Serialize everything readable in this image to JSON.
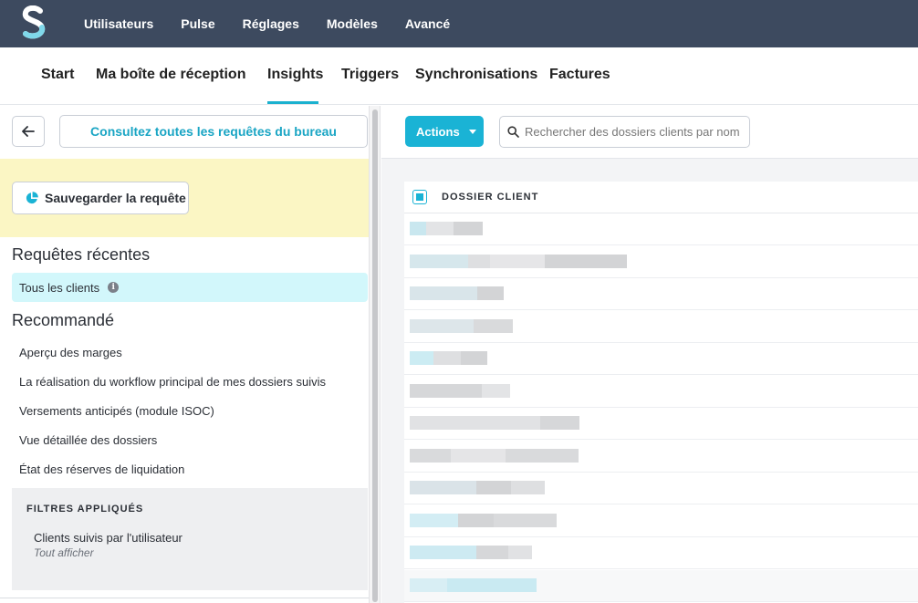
{
  "topnav": {
    "items": [
      "Utilisateurs",
      "Pulse",
      "Réglages",
      "Modèles",
      "Avancé"
    ]
  },
  "subnav": {
    "tabs": [
      "Start",
      "Ma boîte de réception",
      "Insights",
      "Triggers",
      "Synchronisations",
      "Factures"
    ],
    "active": "Insights"
  },
  "left": {
    "consult_label": "Consultez toutes les requêtes du bureau",
    "save_label": "Sauvegarder la requête",
    "recent_title": "Requêtes récentes",
    "recent_item": "Tous les clients",
    "recommended_title": "Recommandé",
    "recommended": [
      "Aperçu des marges",
      "La réalisation du workflow principal de mes dossiers suivis",
      "Versements anticipés (module ISOC)",
      "Vue détaillée des dossiers",
      "État des réserves de liquidation"
    ],
    "filters": {
      "title": "FILTRES APPLIQUÉS",
      "name": "Clients suivis par l'utilisateur",
      "value": "Tout afficher"
    }
  },
  "right": {
    "actions_label": "Actions",
    "search_placeholder": "Rechercher des dossiers clients par nom",
    "column_header": "DOSSIER CLIENT",
    "row_count": 12
  },
  "colors": {
    "topbar": "#3d4a5f",
    "accent": "#1ab3d5",
    "save_bg": "#fbf6c4",
    "recent_bg": "#d2f7fb"
  }
}
